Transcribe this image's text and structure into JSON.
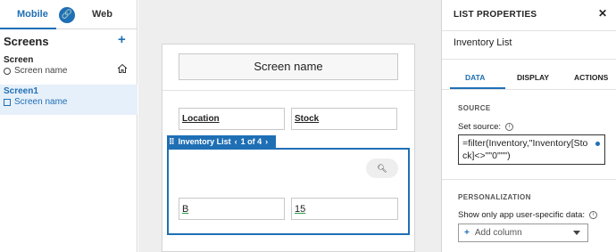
{
  "top_tabs": {
    "mobile": "Mobile",
    "web": "Web",
    "link_icon": "link-icon"
  },
  "screens": {
    "title": "Screens",
    "add": "+",
    "items": [
      {
        "name": "Screen",
        "sub": "Screen name",
        "icon": "circle-icon",
        "home": true
      },
      {
        "name": "Screen1",
        "sub": "Screen name",
        "icon": "square-icon",
        "selected": true
      }
    ]
  },
  "canvas": {
    "header": "Screen name",
    "fields": {
      "location": "Location",
      "stock": "Stock"
    },
    "list": {
      "label": "Inventory List",
      "pager": "1 of 4",
      "search_icon": "search-icon",
      "row": {
        "b": "B",
        "qty": "15"
      }
    }
  },
  "properties": {
    "title": "LIST PROPERTIES",
    "close": "✕",
    "name": "Inventory List",
    "tabs": [
      "DATA",
      "DISPLAY",
      "ACTIONS"
    ],
    "source_section": "SOURCE",
    "set_source_label": "Set source:",
    "formula": "=filter(Inventory,\"Inventory[Stock]<>\"\"0\"\"\")",
    "personalization_section": "PERSONALIZATION",
    "show_only_label": "Show only app user-specific data:",
    "add_column": "Add column"
  },
  "colors": {
    "accent": "#1f6fb5",
    "selected_bg": "#e6f0fa",
    "canvas_bg": "#eeeeee"
  }
}
